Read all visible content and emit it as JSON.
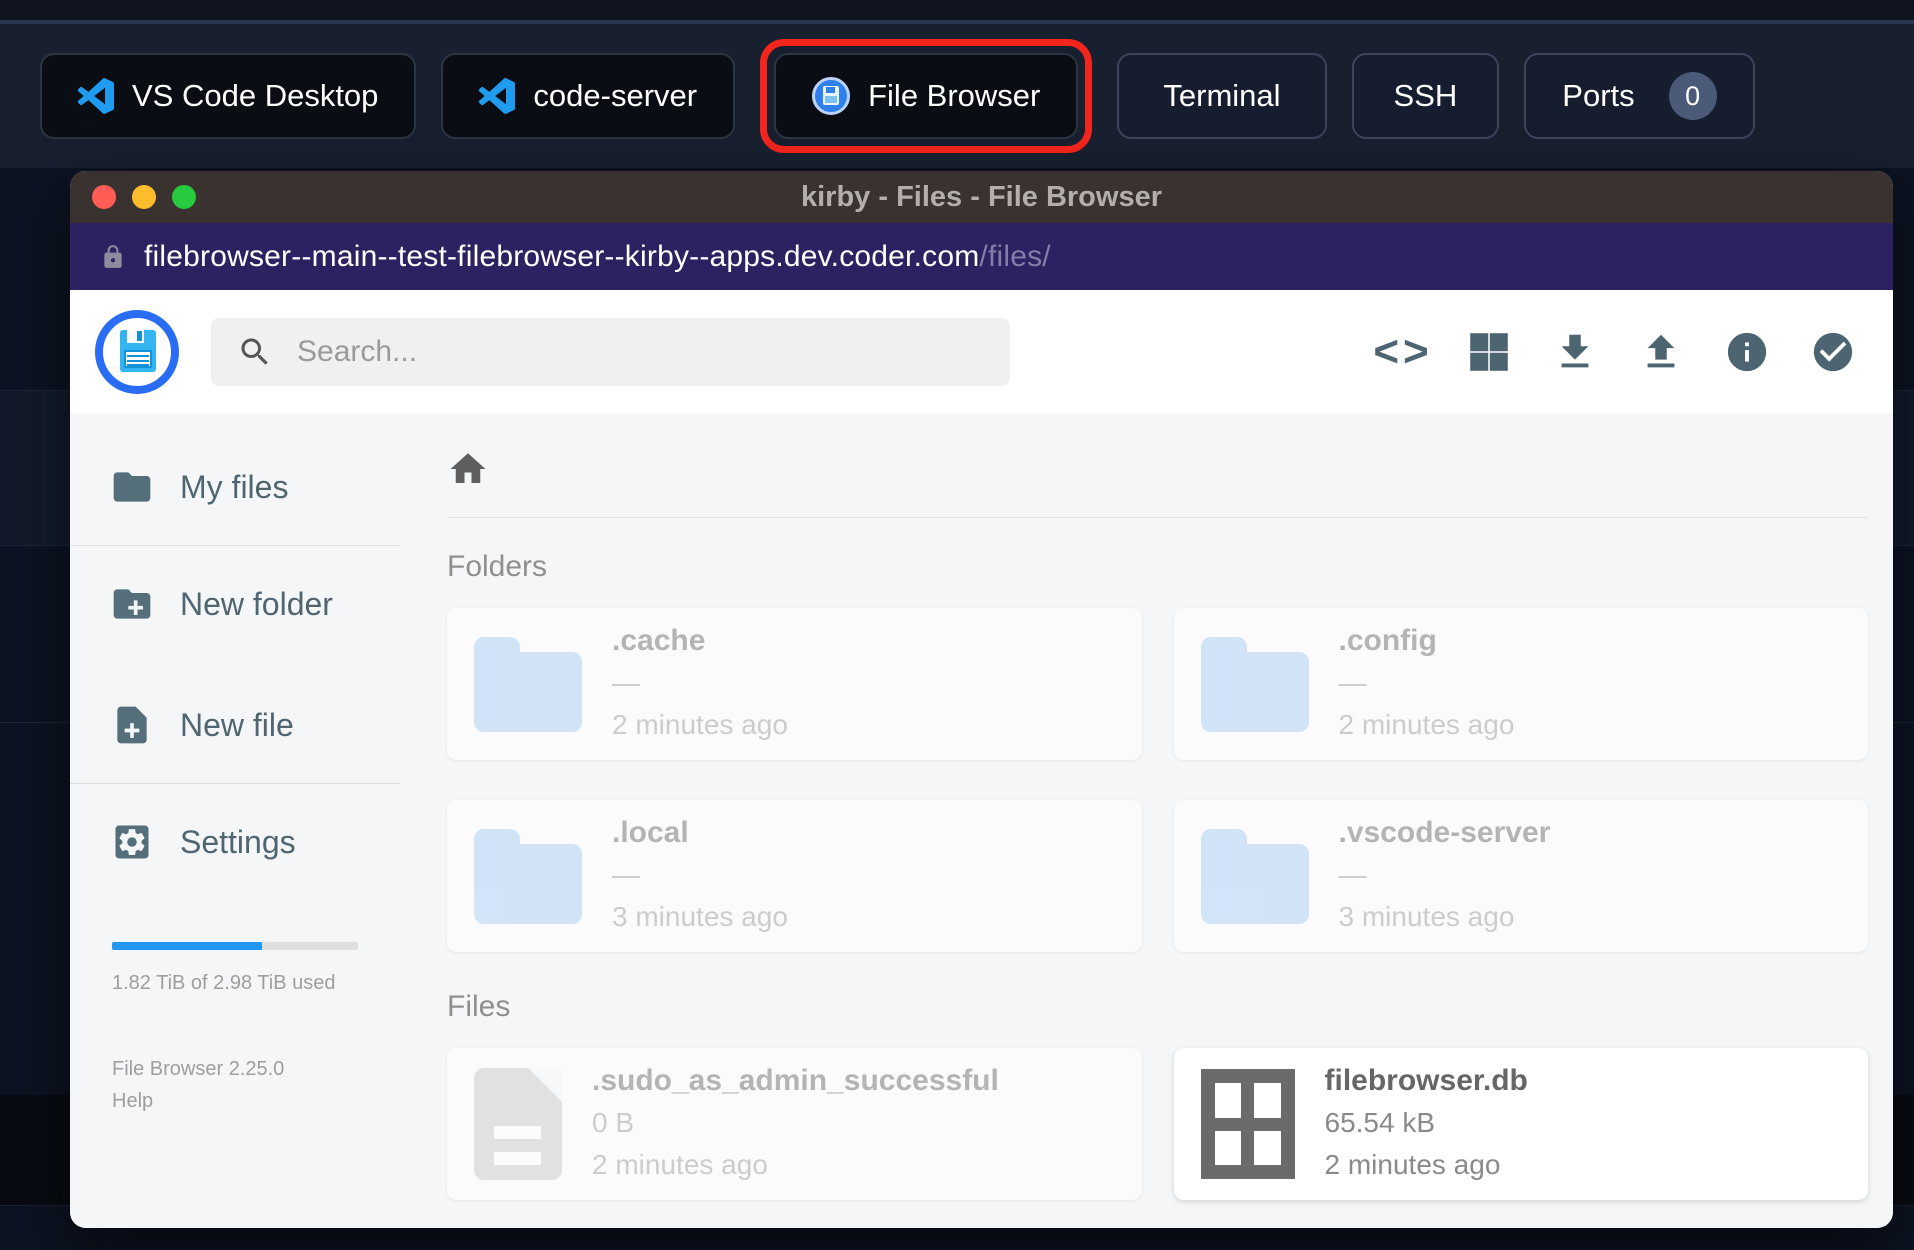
{
  "topbar": {
    "buttons": [
      {
        "label": "VS Code Desktop"
      },
      {
        "label": "code-server"
      },
      {
        "label": "File Browser"
      },
      {
        "label": "Terminal"
      },
      {
        "label": "SSH"
      },
      {
        "label": "Ports"
      }
    ],
    "ports_count": "0",
    "highlight_color": "#f3261d"
  },
  "window": {
    "title": "kirby - Files - File Browser",
    "url_host": "filebrowser--main--test-filebrowser--kirby--apps.dev.coder.com",
    "url_path": "/files/"
  },
  "header": {
    "search_placeholder": "Search...",
    "icons": [
      "code-icon",
      "grid-view-icon",
      "download-icon",
      "upload-icon",
      "info-icon",
      "select-all-icon"
    ]
  },
  "sidebar": {
    "items": [
      {
        "label": "My files"
      },
      {
        "label": "New folder"
      },
      {
        "label": "New file"
      },
      {
        "label": "Settings"
      }
    ],
    "usage_text": "1.82 TiB of 2.98 TiB used",
    "usage_percent": 61,
    "version": "File Browser 2.25.0",
    "help_label": "Help"
  },
  "content": {
    "sections": [
      {
        "title": "Folders",
        "items": [
          {
            "name": ".cache",
            "size": "—",
            "time": "2 minutes ago"
          },
          {
            "name": ".config",
            "size": "—",
            "time": "2 minutes ago"
          },
          {
            "name": ".local",
            "size": "—",
            "time": "3 minutes ago"
          },
          {
            "name": ".vscode-server",
            "size": "—",
            "time": "3 minutes ago"
          }
        ]
      },
      {
        "title": "Files",
        "items": [
          {
            "name": ".sudo_as_admin_successful",
            "size": "0 B",
            "time": "2 minutes ago"
          },
          {
            "name": "filebrowser.db",
            "size": "65.54 kB",
            "time": "2 minutes ago"
          }
        ]
      }
    ]
  },
  "colors": {
    "accent": "#2196f3",
    "icon_slate": "#546e7a",
    "folder_blue": "#a9cdf1"
  }
}
